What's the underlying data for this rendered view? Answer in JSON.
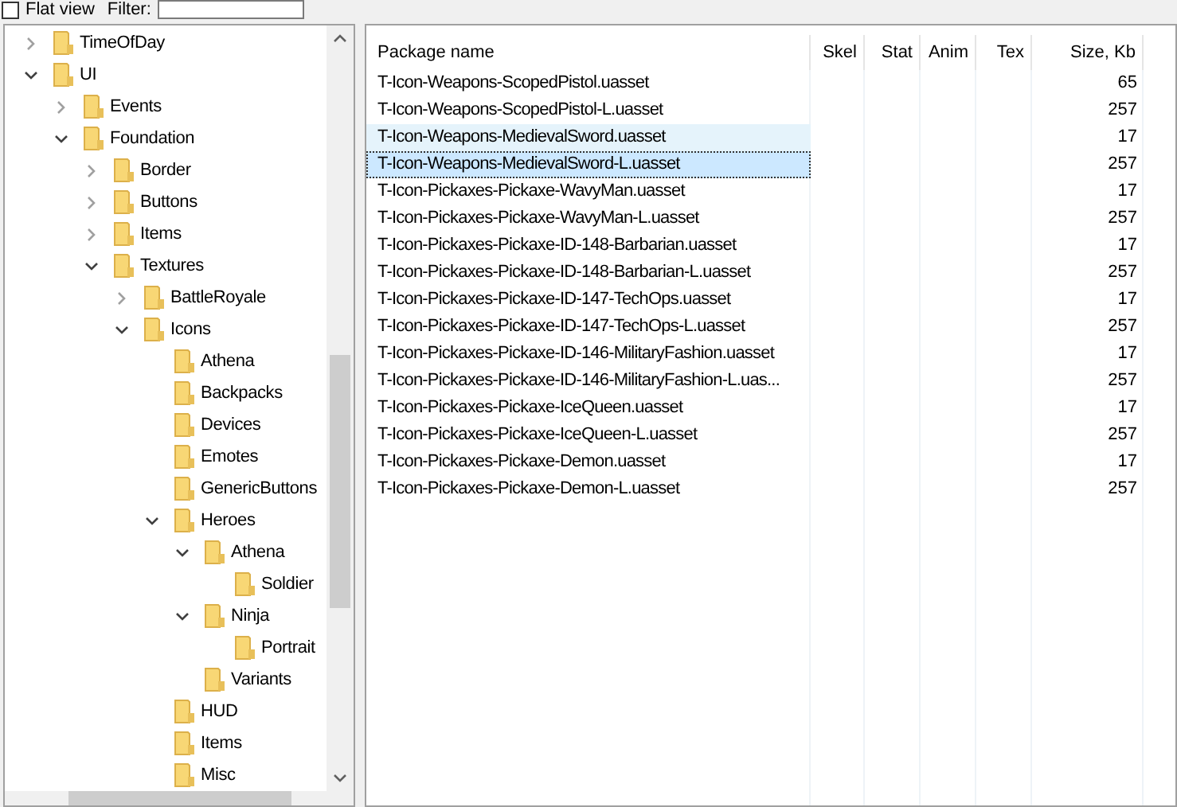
{
  "toolbar": {
    "flat_view": {
      "label": "Flat view",
      "checked": false
    },
    "filter": {
      "label": "Filter:"
    }
  },
  "tree": [
    {
      "label": "TimeOfDay",
      "expanded": false
    },
    {
      "label": "UI",
      "expanded": true,
      "children": [
        {
          "label": "Events",
          "expanded": false
        },
        {
          "label": "Foundation",
          "expanded": true,
          "children": [
            {
              "label": "Border",
              "expanded": false
            },
            {
              "label": "Buttons",
              "expanded": false
            },
            {
              "label": "Items",
              "expanded": false
            },
            {
              "label": "Textures",
              "expanded": true,
              "children": [
                {
                  "label": "BattleRoyale",
                  "expanded": false
                },
                {
                  "label": "Icons",
                  "expanded": true,
                  "children": [
                    {
                      "label": "Athena"
                    },
                    {
                      "label": "Backpacks"
                    },
                    {
                      "label": "Devices"
                    },
                    {
                      "label": "Emotes"
                    },
                    {
                      "label": "GenericButtons"
                    },
                    {
                      "label": "Heroes",
                      "expanded": true,
                      "children": [
                        {
                          "label": "Athena",
                          "expanded": true,
                          "children": [
                            {
                              "label": "Soldier"
                            }
                          ]
                        },
                        {
                          "label": "Ninja",
                          "expanded": true,
                          "children": [
                            {
                              "label": "Portrait"
                            }
                          ]
                        },
                        {
                          "label": "Variants"
                        }
                      ]
                    },
                    {
                      "label": "HUD"
                    },
                    {
                      "label": "Items"
                    },
                    {
                      "label": "Misc"
                    }
                  ]
                }
              ]
            }
          ]
        }
      ]
    }
  ],
  "table": {
    "columns": [
      "Package name",
      "Skel",
      "Stat",
      "Anim",
      "Tex",
      "Size, Kb"
    ],
    "rows": [
      {
        "name": "T-Icon-Weapons-ScopedPistol.uasset",
        "size": "65",
        "selected": false,
        "focused": false
      },
      {
        "name": "T-Icon-Weapons-ScopedPistol-L.uasset",
        "size": "257",
        "selected": false,
        "focused": false
      },
      {
        "name": "T-Icon-Weapons-MedievalSword.uasset",
        "size": "17",
        "selected": true,
        "focused": false
      },
      {
        "name": "T-Icon-Weapons-MedievalSword-L.uasset",
        "size": "257",
        "selected": true,
        "focused": true
      },
      {
        "name": "T-Icon-Pickaxes-Pickaxe-WavyMan.uasset",
        "size": "17",
        "selected": false,
        "focused": false
      },
      {
        "name": "T-Icon-Pickaxes-Pickaxe-WavyMan-L.uasset",
        "size": "257",
        "selected": false,
        "focused": false
      },
      {
        "name": "T-Icon-Pickaxes-Pickaxe-ID-148-Barbarian.uasset",
        "size": "17",
        "selected": false,
        "focused": false
      },
      {
        "name": "T-Icon-Pickaxes-Pickaxe-ID-148-Barbarian-L.uasset",
        "size": "257",
        "selected": false,
        "focused": false
      },
      {
        "name": "T-Icon-Pickaxes-Pickaxe-ID-147-TechOps.uasset",
        "size": "17",
        "selected": false,
        "focused": false
      },
      {
        "name": "T-Icon-Pickaxes-Pickaxe-ID-147-TechOps-L.uasset",
        "size": "257",
        "selected": false,
        "focused": false
      },
      {
        "name": "T-Icon-Pickaxes-Pickaxe-ID-146-MilitaryFashion.uasset",
        "size": "17",
        "selected": false,
        "focused": false
      },
      {
        "name": "T-Icon-Pickaxes-Pickaxe-ID-146-MilitaryFashion-L.uas...",
        "size": "257",
        "selected": false,
        "focused": false
      },
      {
        "name": "T-Icon-Pickaxes-Pickaxe-IceQueen.uasset",
        "size": "17",
        "selected": false,
        "focused": false
      },
      {
        "name": "T-Icon-Pickaxes-Pickaxe-IceQueen-L.uasset",
        "size": "257",
        "selected": false,
        "focused": false
      },
      {
        "name": "T-Icon-Pickaxes-Pickaxe-Demon.uasset",
        "size": "17",
        "selected": false,
        "focused": false
      },
      {
        "name": "T-Icon-Pickaxes-Pickaxe-Demon-L.uasset",
        "size": "257",
        "selected": false,
        "focused": false
      }
    ]
  }
}
